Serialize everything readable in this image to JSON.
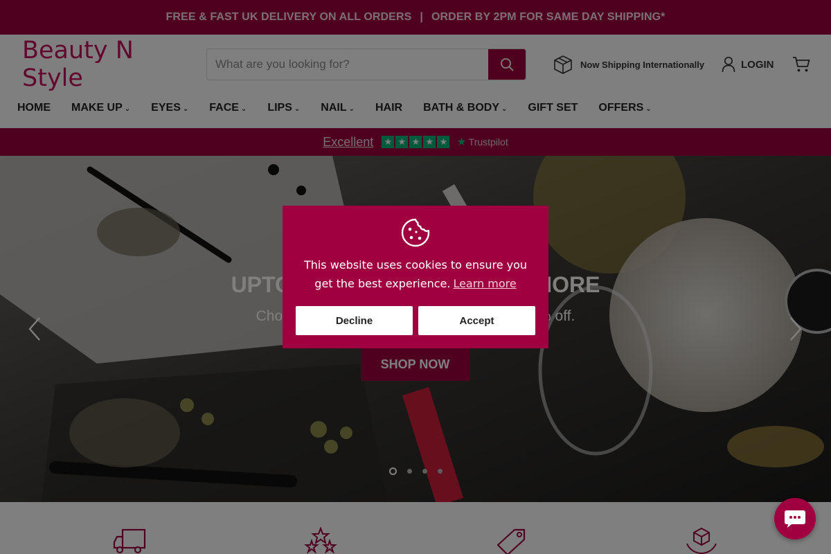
{
  "announcement": {
    "left": "FREE & FAST UK DELIVERY ON ALL ORDERS",
    "separator": "|",
    "right": "ORDER BY 2PM FOR SAME DAY SHIPPING*"
  },
  "header": {
    "logo": "Beauty N Style",
    "search_placeholder": "What are you looking for?",
    "shipping_note": "Now Shipping Internationally",
    "login_label": "LOGIN",
    "icons": [
      "search-icon",
      "box-icon",
      "user-icon",
      "cart-icon"
    ]
  },
  "nav": {
    "items": [
      {
        "label": "HOME",
        "dropdown": false
      },
      {
        "label": "MAKE UP",
        "dropdown": true
      },
      {
        "label": "EYES",
        "dropdown": true
      },
      {
        "label": "FACE",
        "dropdown": true
      },
      {
        "label": "LIPS",
        "dropdown": true
      },
      {
        "label": "NAIL",
        "dropdown": true
      },
      {
        "label": "HAIR",
        "dropdown": false
      },
      {
        "label": "BATH & BODY",
        "dropdown": true
      },
      {
        "label": "GIFT SET",
        "dropdown": false
      },
      {
        "label": "OFFERS",
        "dropdown": true
      }
    ],
    "chevron": "⌄"
  },
  "trustpilot": {
    "rating_text": "Excellent",
    "stars": 5,
    "brand": "Trustpilot"
  },
  "hero": {
    "title": "UPTO 20% OFF ON £100 OR MORE",
    "subtitle": "Choose from our collection and get up to 20% off.",
    "button": "SHOP NOW",
    "slide_count": 4,
    "active_slide": 1
  },
  "cookie_banner": {
    "message": "This website uses cookies to ensure you get the best experience.",
    "learn_more": "Learn more",
    "decline": "Decline",
    "accept": "Accept"
  },
  "features": {
    "icons": [
      "delivery-truck-icon",
      "stars-icon",
      "price-tag-icon",
      "returns-box-icon"
    ]
  },
  "colors": {
    "brand": "#a0003f",
    "trustpilot_green": "#00b67a",
    "logo": "#c4115c"
  }
}
